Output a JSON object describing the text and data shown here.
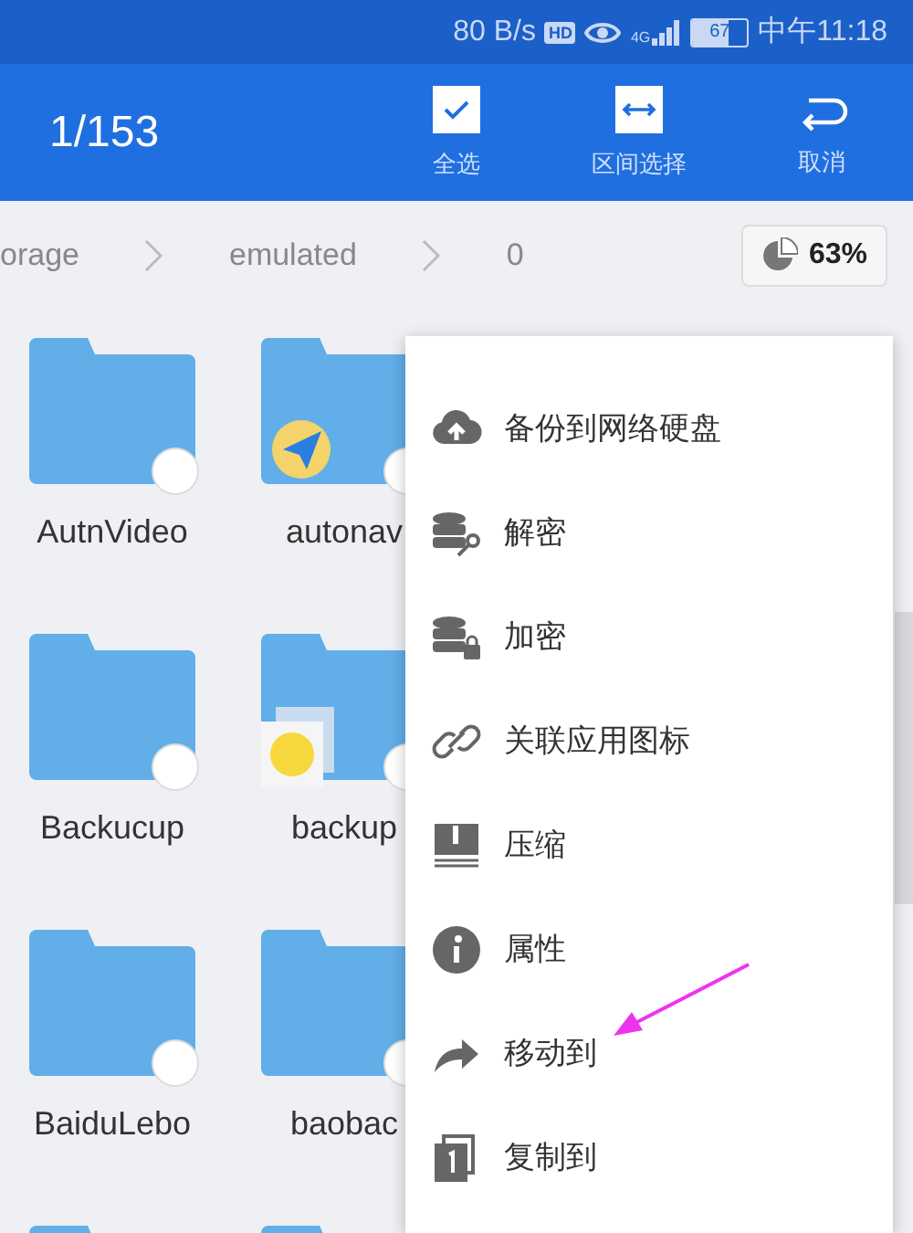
{
  "status_bar": {
    "speed": "80 B/s",
    "hd": "HD",
    "network": "4G",
    "battery": "67",
    "time": "中午11:18"
  },
  "toolbar": {
    "count": "1/153",
    "actions": [
      {
        "label": "全选"
      },
      {
        "label": "区间选择"
      },
      {
        "label": "取消"
      }
    ]
  },
  "breadcrumb": {
    "parts": [
      "orage",
      "emulated",
      "0"
    ],
    "storage": "63%"
  },
  "folders": [
    {
      "name": "AutnVideo",
      "selected": false,
      "kind": "plain"
    },
    {
      "name": "autonav",
      "selected": false,
      "kind": "nav"
    },
    {
      "name": "Backucup",
      "selected": false,
      "kind": "plain"
    },
    {
      "name": "backup",
      "selected": false,
      "kind": "backup"
    },
    {
      "name": "BaiduLebo",
      "selected": false,
      "kind": "plain"
    },
    {
      "name": "baobac",
      "selected": false,
      "kind": "plain"
    },
    {
      "kind": "plain"
    },
    {
      "kind": "plain"
    }
  ],
  "menu": {
    "items": [
      {
        "label": "备份到网络硬盘"
      },
      {
        "label": "解密"
      },
      {
        "label": "加密"
      },
      {
        "label": "关联应用图标"
      },
      {
        "label": "压缩"
      },
      {
        "label": "属性"
      },
      {
        "label": "移动到"
      },
      {
        "label": "复制到"
      }
    ]
  }
}
